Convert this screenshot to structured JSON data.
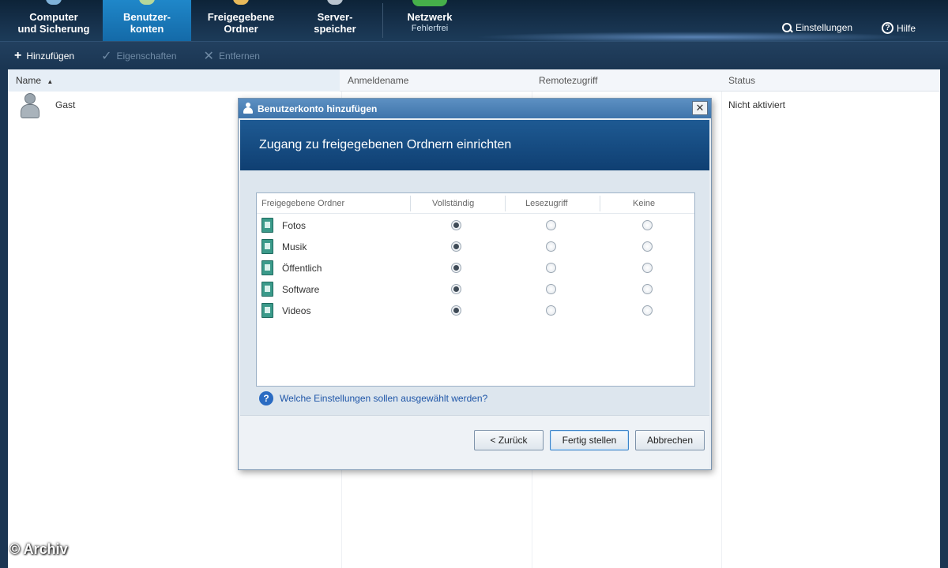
{
  "nav": {
    "tabs": [
      {
        "line1": "Computer",
        "line2": "und Sicherung",
        "sub": ""
      },
      {
        "line1": "Benutzer-",
        "line2": "konten",
        "sub": ""
      },
      {
        "line1": "Freigegebene",
        "line2": "Ordner",
        "sub": ""
      },
      {
        "line1": "Server-",
        "line2": "speicher",
        "sub": ""
      },
      {
        "line1": "Netzwerk",
        "line2": "",
        "sub": "Fehlerfrei"
      }
    ],
    "settings_label": "Einstellungen",
    "help_label": "Hilfe",
    "active_color": "#1f87c9"
  },
  "toolbar": {
    "add_label": "Hinzufügen",
    "properties_label": "Eigenschaften",
    "remove_label": "Entfernen"
  },
  "list": {
    "columns": [
      "Name",
      "Anmeldename",
      "Remotezugriff",
      "Status"
    ],
    "sort_indicator": "▲",
    "rows": [
      {
        "name": "Gast",
        "login": "",
        "remote": "",
        "status": "Nicht aktiviert"
      }
    ]
  },
  "dialog": {
    "title": "Benutzerkonto hinzufügen",
    "close_glyph": "✕",
    "heading": "Zugang zu freigegebenen Ordnern einrichten",
    "table_headers": [
      "Freigegebene Ordner",
      "Vollständig",
      "Lesezugriff",
      "Keine"
    ],
    "folders": [
      {
        "name": "Fotos",
        "access": "Vollständig"
      },
      {
        "name": "Musik",
        "access": "Vollständig"
      },
      {
        "name": "Öffentlich",
        "access": "Vollständig"
      },
      {
        "name": "Software",
        "access": "Vollständig"
      },
      {
        "name": "Videos",
        "access": "Vollständig"
      }
    ],
    "help_text": "Welche Einstellungen sollen ausgewählt werden?",
    "back_label": "< Zurück",
    "finish_label": "Fertig stellen",
    "cancel_label": "Abbrechen"
  },
  "watermark": "© Archiv"
}
